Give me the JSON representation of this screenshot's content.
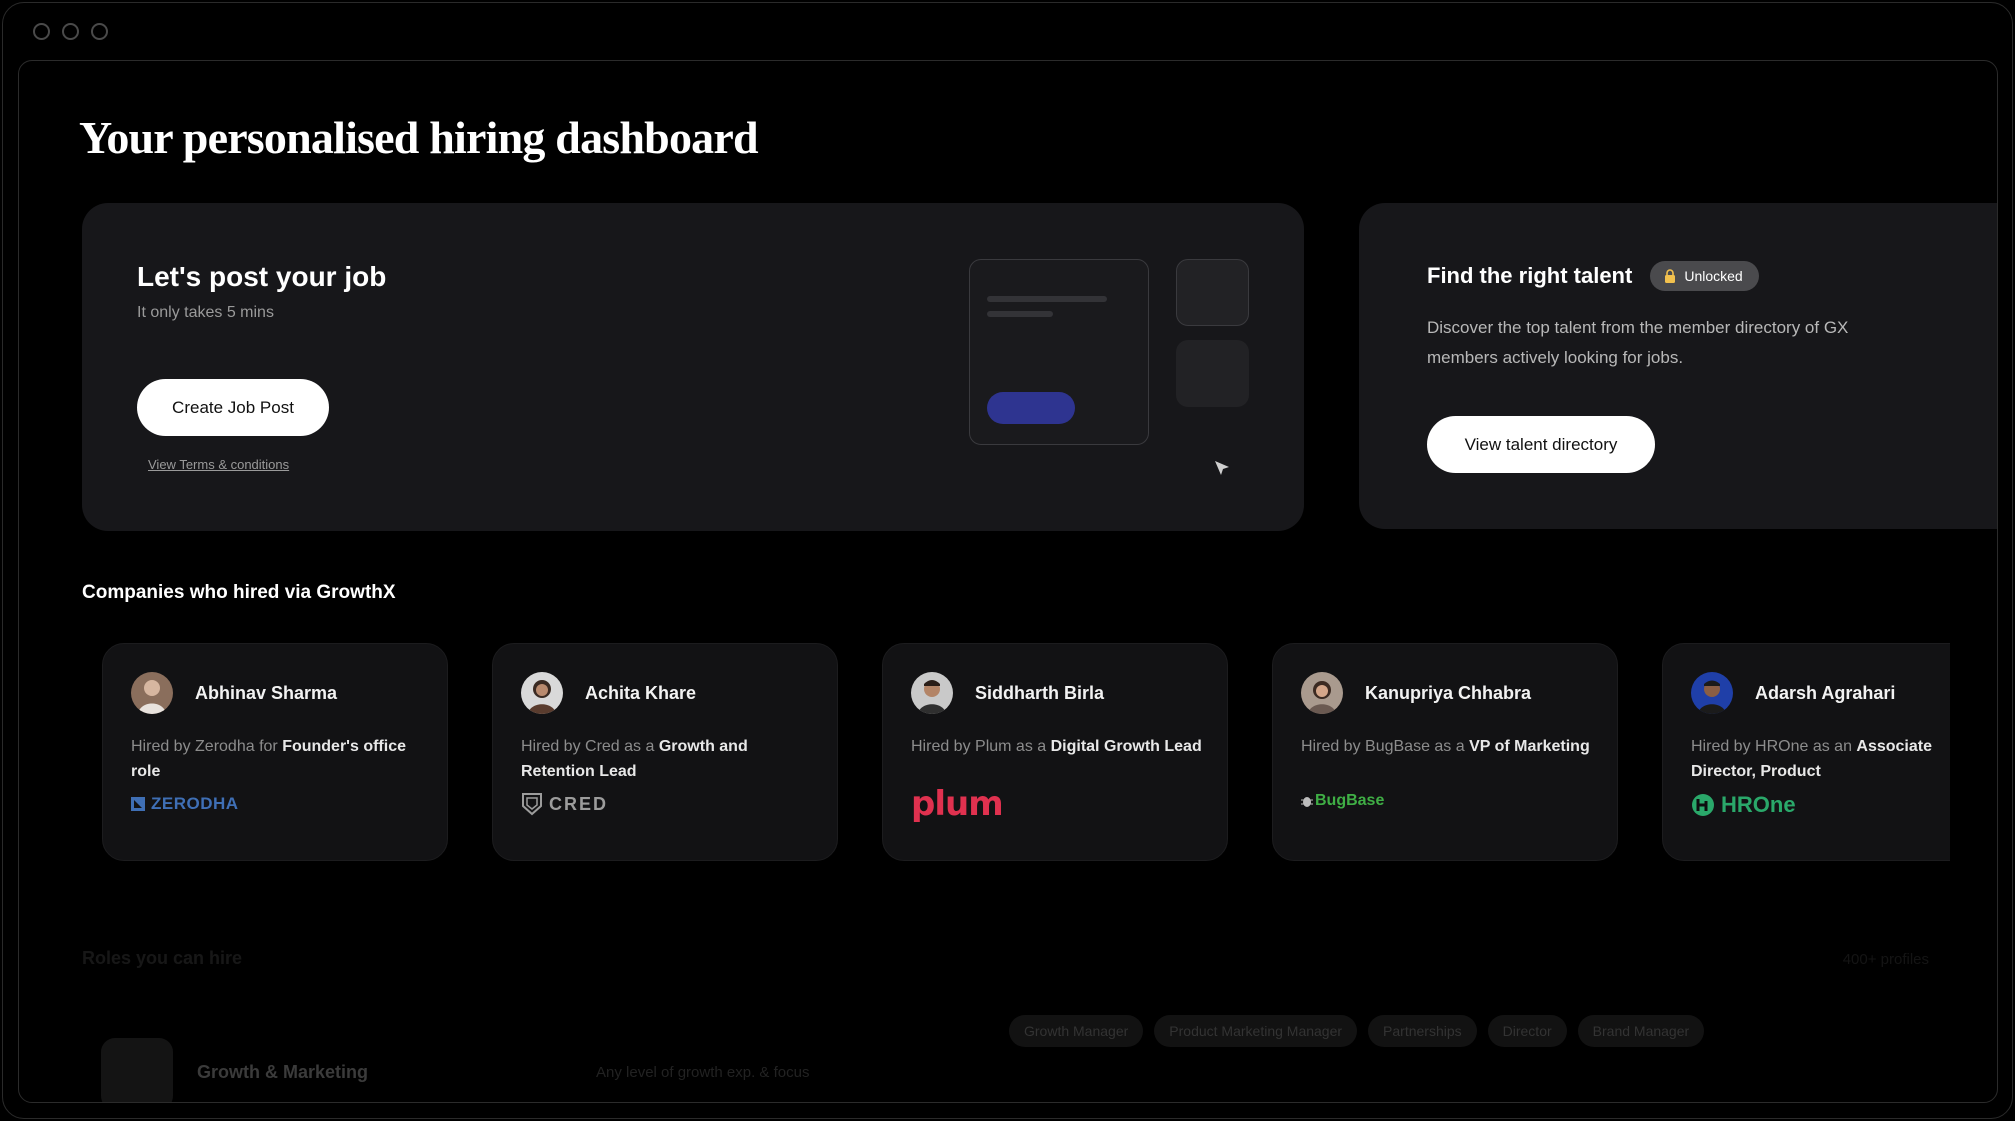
{
  "page": {
    "title": "Your personalised hiring dashboard"
  },
  "job_card": {
    "title": "Let's post your job",
    "subtitle": "It only takes 5 mins",
    "create_label": "Create Job Post",
    "terms_label": "View Terms & conditions"
  },
  "talent_card": {
    "title": "Find the right talent",
    "badge": "Unlocked",
    "description": "Discover the top talent from the member directory of GX members actively looking for jobs.",
    "button_label": "View talent directory"
  },
  "companies": {
    "title": "Companies who hired via GrowthX",
    "items": [
      {
        "name": "Abhinav Sharma",
        "prefix": "Hired by Zerodha for ",
        "role": "Founder's office role",
        "logo": "ZERODHA",
        "logo_color": "#3f6fb5"
      },
      {
        "name": "Achita Khare",
        "prefix": "Hired by Cred as a ",
        "role": "Growth and Retention Lead",
        "logo": "CRED",
        "logo_color": "#9c9c9c"
      },
      {
        "name": "Siddharth Birla",
        "prefix": "Hired by Plum as a ",
        "role": "Digital Growth Lead",
        "logo": "plum",
        "logo_color": "#e0314f"
      },
      {
        "name": "Kanupriya Chhabra",
        "prefix": "Hired by BugBase as a ",
        "role": "VP of Marketing",
        "logo": "BugBase",
        "logo_color": "#3fae45"
      },
      {
        "name": "Adarsh Agrahari",
        "prefix": "Hired by HROne as an ",
        "role": "Associate Director, Product",
        "logo": "HROne",
        "logo_color": "#2aa86a"
      }
    ]
  },
  "roles": {
    "title": "Roles you can hire",
    "count": "400+ profiles",
    "first_role": {
      "name": "Growth & Marketing",
      "sub": "Any level of growth exp. & focus"
    },
    "chips": [
      "Growth Manager",
      "Product Marketing Manager",
      "Partnerships",
      "Director",
      "Brand Manager"
    ]
  },
  "colors": {
    "accent": "#2e3490",
    "card_bg": "#17171a",
    "background": "#000000"
  }
}
